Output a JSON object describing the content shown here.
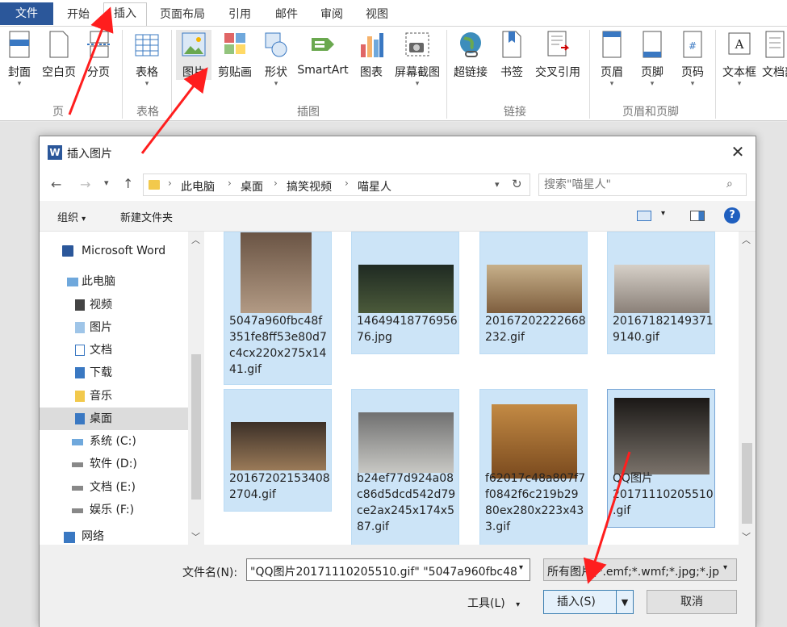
{
  "ribbon_tabs": [
    "文件",
    "开始",
    "插入",
    "页面布局",
    "引用",
    "邮件",
    "审阅",
    "视图"
  ],
  "ribbon": {
    "groups": [
      {
        "label": "页",
        "buttons": [
          "封面",
          "空白页",
          "分页"
        ]
      },
      {
        "label": "表格",
        "buttons": [
          "表格"
        ]
      },
      {
        "label": "插图",
        "buttons": [
          "图片",
          "剪贴画",
          "形状",
          "SmartArt",
          "图表",
          "屏幕截图"
        ]
      },
      {
        "label": "链接",
        "buttons": [
          "超链接",
          "书签",
          "交叉引用"
        ]
      },
      {
        "label": "页眉和页脚",
        "buttons": [
          "页眉",
          "页脚",
          "页码"
        ]
      },
      {
        "label": "",
        "buttons": [
          "文本框",
          "文档部"
        ]
      }
    ]
  },
  "dialog": {
    "title": "插入图片",
    "title_icon": "W",
    "breadcrumb": [
      "此电脑",
      "桌面",
      "搞笑视频",
      "喵星人"
    ],
    "search_placeholder": "搜索\"喵星人\"",
    "organize": "组织",
    "new_folder": "新建文件夹",
    "help": "?",
    "nav": [
      {
        "label": "Microsoft Word",
        "icon": "word-icon"
      },
      {
        "label": "此电脑",
        "icon": "computer-icon"
      },
      {
        "label": "视频",
        "icon": "video-folder-icon"
      },
      {
        "label": "图片",
        "icon": "picture-folder-icon"
      },
      {
        "label": "文档",
        "icon": "document-folder-icon"
      },
      {
        "label": "下载",
        "icon": "download-folder-icon"
      },
      {
        "label": "音乐",
        "icon": "music-folder-icon"
      },
      {
        "label": "桌面",
        "icon": "desktop-folder-icon"
      },
      {
        "label": "系统 (C:)",
        "icon": "drive-icon"
      },
      {
        "label": "软件 (D:)",
        "icon": "drive-icon"
      },
      {
        "label": "文档 (E:)",
        "icon": "drive-icon"
      },
      {
        "label": "娱乐 (F:)",
        "icon": "drive-icon"
      },
      {
        "label": "网络",
        "icon": "network-icon"
      }
    ],
    "files": [
      {
        "name": "5047a960fbc48f351fe8ff53e80d7c4cx220x275x1441.gif",
        "lines": [
          "5047a960fbc48f",
          "351fe8ff53e80d7",
          "c4cx220x275x14",
          "41.gif"
        ],
        "thumb": "#8a6a55"
      },
      {
        "name": "1464941877695676.jpg",
        "lines": [
          "14649418776956",
          "76.jpg"
        ],
        "thumb": "#2c3a2a"
      },
      {
        "name": "20167202222668232.gif",
        "lines": [
          "20167202222668",
          "232.gif"
        ],
        "thumb": "#a89070"
      },
      {
        "name": "201671821493719140.gif",
        "lines": [
          "20167182149371",
          "9140.gif"
        ],
        "thumb": "#b0a7a0"
      },
      {
        "name": "201672021534082704.gif",
        "lines": [
          "20167202153408",
          "2704.gif"
        ],
        "thumb": "#5a4a38"
      },
      {
        "name": "b24ef77d924a08c86d5dcd542d79ce2ax245x174x587.gif",
        "lines": [
          "b24ef77d924a08",
          "c86d5dcd542d79",
          "ce2ax245x174x5",
          "87.gif"
        ],
        "thumb": "#8a8a88"
      },
      {
        "name": "f62017c48a807f7f0842f6c219b2980ex280x223x433.gif",
        "lines": [
          "f62017c48a807f7",
          "f0842f6c219b29",
          "80ex280x223x43",
          "3.gif"
        ],
        "thumb": "#b07a3a"
      },
      {
        "name": "QQ图片20171110205510.gif",
        "lines": [
          "QQ图片",
          "20171110205510",
          ".gif"
        ],
        "thumb": "#4a4540"
      }
    ],
    "filename_label": "文件名(N):",
    "filename_value": "\"QQ图片20171110205510.gif\" \"5047a960fbc48",
    "filetype_value": "所有图片(*.emf;*.wmf;*.jpg;*.jp",
    "tools_label": "工具(L)",
    "insert_label": "插入(S)",
    "cancel_label": "取消"
  },
  "colors": {
    "accent": "#2b579a",
    "selection": "#cce4f7",
    "annotation_arrow": "#ff1e1e"
  }
}
